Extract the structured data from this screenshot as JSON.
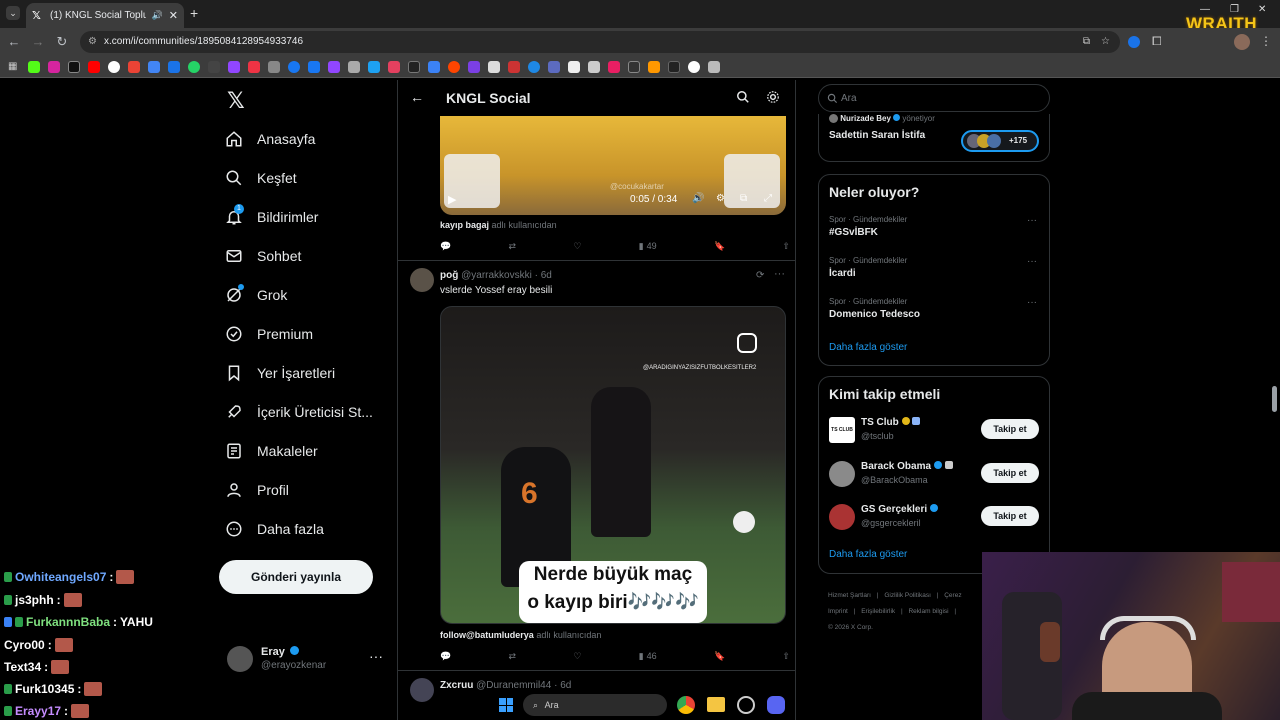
{
  "browser": {
    "tab_title": "(1) KNGL Social Topluluk / X",
    "url": "x.com/i/communities/1895084128954933746"
  },
  "stream": {
    "logo_text": "WRAITH"
  },
  "nav": {
    "items": [
      {
        "label": "Anasayfa"
      },
      {
        "label": "Keşfet"
      },
      {
        "label": "Bildirimler"
      },
      {
        "label": "Sohbet"
      },
      {
        "label": "Grok"
      },
      {
        "label": "Premium"
      },
      {
        "label": "Yer İşaretleri"
      },
      {
        "label": "İçerik Üreticisi St..."
      },
      {
        "label": "Makaleler"
      },
      {
        "label": "Profil"
      },
      {
        "label": "Daha fazla"
      }
    ],
    "notification_count": "1",
    "post_button": "Gönderi yayınla",
    "account": {
      "name": "Eray",
      "handle": "@erayozkenar"
    }
  },
  "main": {
    "header_title": "KNGL Social",
    "tweet1": {
      "video_time": "0:05 / 0:34",
      "video_watermark": "@cocukakartar",
      "caption_user": "kayıp bagaj",
      "caption_suffix": "adlı kullanıcıdan",
      "views": "49"
    },
    "tweet2": {
      "name": "poğ",
      "handle": "@yarrakkovskki",
      "time": "· 6d",
      "text": "vslerde Yossef eray besili",
      "media_watermark": "@ARADIGINYAZISIZFUTBOLKESITLER2",
      "media_caption_line1": "Nerde büyük maç",
      "media_caption_line2": "o kayıp biri🎶🎶🎶",
      "jersey_number": "6",
      "caption_user": "follow@batumluderya",
      "caption_suffix": "adlı kullanıcıdan",
      "views": "46"
    },
    "tweet3": {
      "name": "Zxcruu",
      "handle": "@Duranemmil44",
      "time": "· 6d"
    }
  },
  "right": {
    "search_placeholder": "Ara",
    "community": {
      "mod_name": "Nurizade Bey",
      "mod_role": "yönetiyor",
      "title": "Sadettin Saran İstifa",
      "member_count": "+175"
    },
    "trends_title": "Neler oluyor?",
    "trends": [
      {
        "category": "Spor · Gündemdekiler",
        "name": "#GSvİBFK"
      },
      {
        "category": "Spor · Gündemdekiler",
        "name": "İcardi"
      },
      {
        "category": "Spor · Gündemdekiler",
        "name": "Domenico Tedesco"
      }
    ],
    "show_more": "Daha fazla göster",
    "who_to_follow_title": "Kimi takip etmeli",
    "follow": [
      {
        "name": "TS Club",
        "handle": "@tsclub",
        "button": "Takip et",
        "avatar_text": "TS CLUB"
      },
      {
        "name": "Barack Obama",
        "handle": "@BarackObama",
        "button": "Takip et"
      },
      {
        "name": "GS Gerçekleri",
        "handle": "@gsgercekleril",
        "button": "Takip et"
      }
    ],
    "footer_links": [
      "Hizmet Şartları",
      "|",
      "Gizlilik Politikası",
      "|",
      "Çerez",
      "Imprint",
      "|",
      "Erişilebilirlik",
      "|",
      "Reklam bilgisi",
      "|"
    ],
    "copyright": "© 2026 X Corp."
  },
  "chat": [
    {
      "user": "Owhiteangels07",
      "sep": ":",
      "msg": "",
      "color": "#6fa8ff"
    },
    {
      "user": "js3phh",
      "sep": ":",
      "msg": "",
      "color": "#ffffff"
    },
    {
      "user": "FurkannnBaba",
      "sep": ":",
      "msg": "YAHU",
      "color": "#7fe07f"
    },
    {
      "user": "Cyro00",
      "sep": ":",
      "msg": "",
      "color": "#ffffff"
    },
    {
      "user": "Text34",
      "sep": ":",
      "msg": "",
      "color": "#ffffff"
    },
    {
      "user": "Furk10345",
      "sep": ":",
      "msg": "",
      "color": "#ffffff"
    },
    {
      "user": "Erayy17",
      "sep": ":",
      "msg": "",
      "color": "#c58cff"
    }
  ],
  "taskbar": {
    "search_placeholder": "Ara"
  }
}
